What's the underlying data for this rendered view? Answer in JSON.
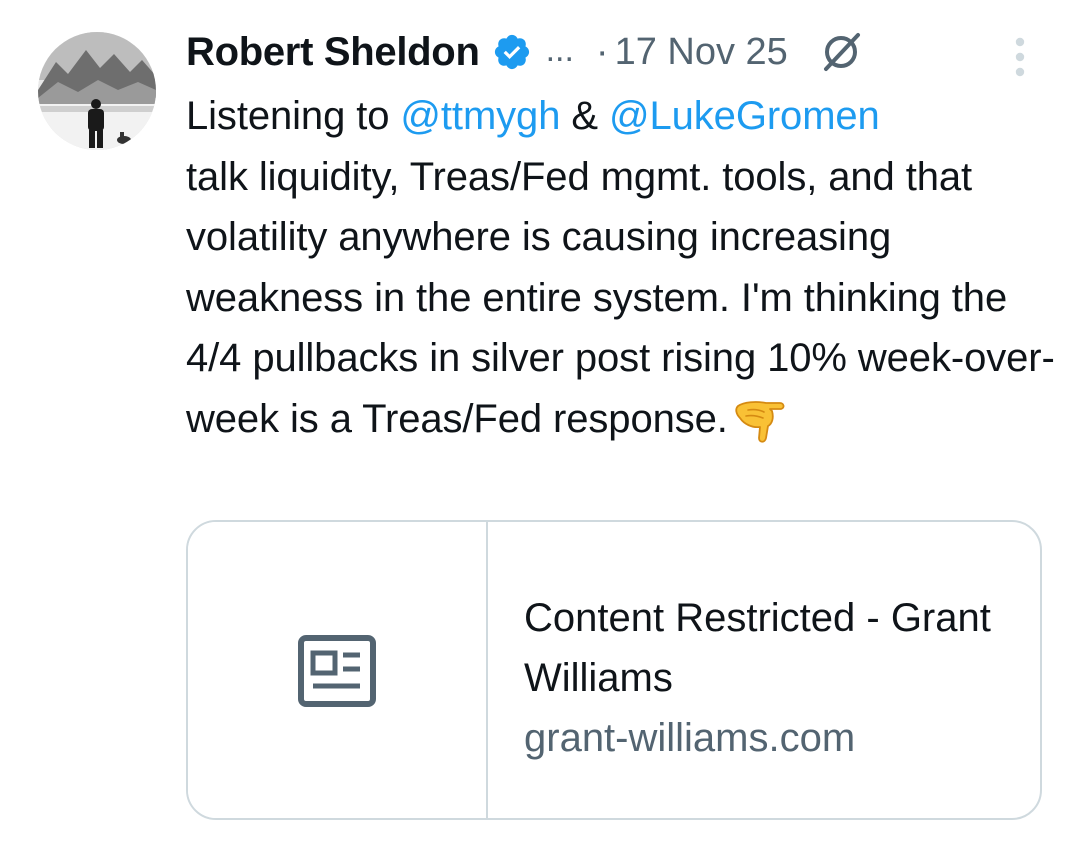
{
  "tweet": {
    "author": {
      "name": "Robert Sheldon",
      "truncation": "..."
    },
    "separator": "·",
    "timestamp": "17 Nov 25",
    "text": {
      "line1_prefix": "Listening to ",
      "mention1": "@ttmygh",
      "line1_mid": " & ",
      "mention2": "@LukeGromen",
      "body": "talk liquidity, Treas/Fed mgmt. tools, and that volatility anywhere is causing increasing weakness in the entire system. I'm thinking the 4/4 pullbacks in silver post rising 10% week-over-week is a Treas/Fed response."
    }
  },
  "link_card": {
    "title": "Content Restricted - Grant Williams",
    "domain": "grant-williams.com"
  },
  "icons": {
    "verified": "verified-badge-icon",
    "grok": "grok-icon",
    "more": "more-vertical-icon",
    "emoji": "backhand-index-pointing-down",
    "card_thumb": "article-icon"
  },
  "colors": {
    "text": "#0f1419",
    "secondary": "#536471",
    "mention": "#1d9bf0",
    "verified": "#1d9bf0",
    "border": "#cfd9de"
  }
}
